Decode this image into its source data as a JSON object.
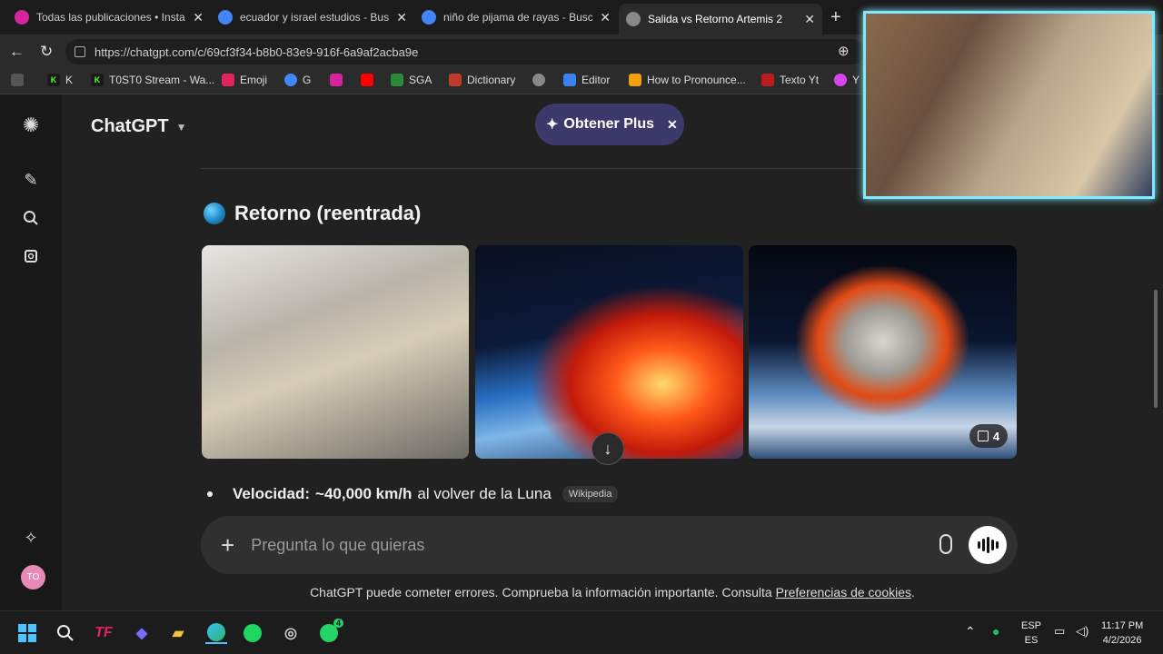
{
  "browser": {
    "tabs": [
      {
        "title": "Todas las publicaciones • Instagram",
        "icon": "instagram-icon",
        "color": "#d6249f"
      },
      {
        "title": "ecuador y israel estudios - Buscar con Google",
        "icon": "google-icon",
        "color": "#4285f4"
      },
      {
        "title": "niño de pijama de rayas - Buscar con Google",
        "icon": "google-icon",
        "color": "#4285f4"
      },
      {
        "title": "Salida vs Retorno Artemis 2",
        "icon": "chatgpt-icon",
        "color": "#888888"
      }
    ],
    "close_glyph": "✕",
    "new_tab_glyph": "+",
    "url": "https://chatgpt.com/c/69cf3f34-b8b0-83e9-916f-6a9af2acba9e",
    "bookmarks": [
      {
        "label": "K",
        "color": "#53fc18"
      },
      {
        "label": "T0ST0 Stream - Wa...",
        "color": "#53fc18"
      },
      {
        "label": "Emoji",
        "color": "#e0245e"
      },
      {
        "label": "G",
        "color": "#4285f4"
      },
      {
        "label": "",
        "color": "#d6249f"
      },
      {
        "label": "",
        "color": "#ff0000"
      },
      {
        "label": "SGA",
        "color": "#2a8a3a"
      },
      {
        "label": "Dictionary",
        "color": "#c0392b"
      },
      {
        "label": "",
        "color": "#888888"
      },
      {
        "label": "Editor",
        "color": "#3b82f6"
      },
      {
        "label": "How to Pronounce...",
        "color": "#f59e0b"
      },
      {
        "label": "Texto Yt",
        "color": "#b91c1c"
      },
      {
        "label": "Y",
        "color": "#d946ef"
      }
    ]
  },
  "app": {
    "model_name": "ChatGPT",
    "plus_label": "Obtener Plus",
    "avatar_initials": "TO"
  },
  "content": {
    "heading": "Retorno (reentrada)",
    "image_count": "4",
    "bullet_label": "Velocidad:",
    "bullet_value": "~40,000 km/h",
    "bullet_rest": "al volver de la Luna",
    "source_badge": "Wikipedia"
  },
  "composer": {
    "placeholder": "Pregunta lo que quieras"
  },
  "footer": {
    "text": "ChatGPT puede cometer errores. Comprueba la información importante. Consulta",
    "link": "Preferencias de cookies",
    "end": "."
  },
  "taskbar": {
    "lang_top": "ESP",
    "lang_bottom": "ES",
    "time": "11:17 PM",
    "date": "4/2/2026",
    "whatsapp_badge": "4"
  }
}
